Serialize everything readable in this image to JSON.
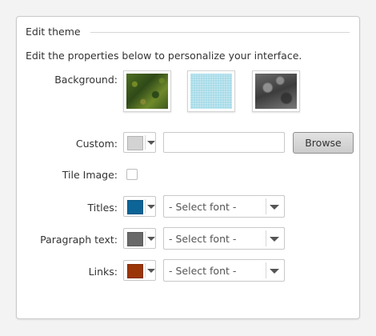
{
  "section": {
    "legend": "Edit theme",
    "intro": "Edit the properties below to personalize your interface."
  },
  "background": {
    "label": "Background:",
    "thumbnails": [
      {
        "name": "green-moss-texture"
      },
      {
        "name": "light-blue-texture"
      },
      {
        "name": "gray-stone-texture"
      }
    ]
  },
  "custom": {
    "label": "Custom:",
    "swatch_color": "#d3d3d3",
    "file_value": "",
    "browse_label": "Browse"
  },
  "tile_image": {
    "label": "Tile Image:",
    "checked": false
  },
  "titles": {
    "label": "Titles:",
    "swatch_color": "#0c6497",
    "font_value": "- Select font -"
  },
  "paragraph": {
    "label": "Paragraph text:",
    "swatch_color": "#696969",
    "font_value": "- Select font -"
  },
  "links": {
    "label": "Links:",
    "swatch_color": "#9a3508",
    "font_value": "- Select font -"
  }
}
